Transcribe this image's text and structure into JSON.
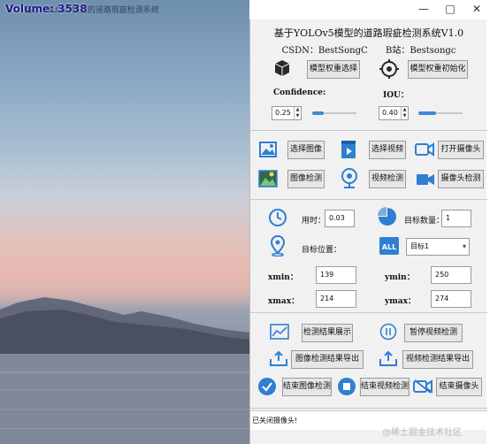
{
  "window": {
    "title": "基于YOLOv5模型的道路瑕疵检测系统",
    "volume": "Volume: 3538",
    "minimize": "—",
    "maximize": "□",
    "close": "✕"
  },
  "header": {
    "title": "基于YOLOv5模型的道路瑕疵检测系统V1.0",
    "csdn": "CSDN：BestSongC",
    "bilibili": "B站：Bestsongc"
  },
  "model": {
    "select_weights": "模型权重选择",
    "init_weights": "模型权重初始化",
    "confidence_label": "Confidence:",
    "confidence_value": "0.25",
    "confidence_level": 0.25,
    "iou_label": "IOU：",
    "iou_value": "0.40",
    "iou_level": 0.4
  },
  "input": {
    "select_image": "选择图像",
    "select_video": "选择视频",
    "open_camera": "打开摄像头",
    "image_detect": "图像检测",
    "video_detect": "视频检测",
    "camera_detect": "摄像头检测"
  },
  "result": {
    "time_label": "用时：",
    "time_value": "0.03",
    "count_label": "目标数量：",
    "count_value": "1",
    "position_label": "目标位置：",
    "target_select": "目标1",
    "xmin_label": "xmin：",
    "xmin_value": "139",
    "ymin_label": "ymin：",
    "ymin_value": "250",
    "xmax_label": "xmax：",
    "xmax_value": "214",
    "ymax_label": "ymax：",
    "ymax_value": "274"
  },
  "actions": {
    "show_result": "检测结果展示",
    "pause_video": "暂停视频检测",
    "export_image": "图像检测结果导出",
    "export_video": "视频检测结果导出",
    "end_image": "结束图像检测",
    "end_video": "结束视频检测",
    "end_camera": "结束摄像头"
  },
  "status": {
    "message": "已关闭摄像头!"
  },
  "watermark": "@稀土掘金技术社区",
  "colors": {
    "accent": "#2b7fd6",
    "icon_blue": "#2f7fd2",
    "panel_bg": "#f1f1f1"
  }
}
